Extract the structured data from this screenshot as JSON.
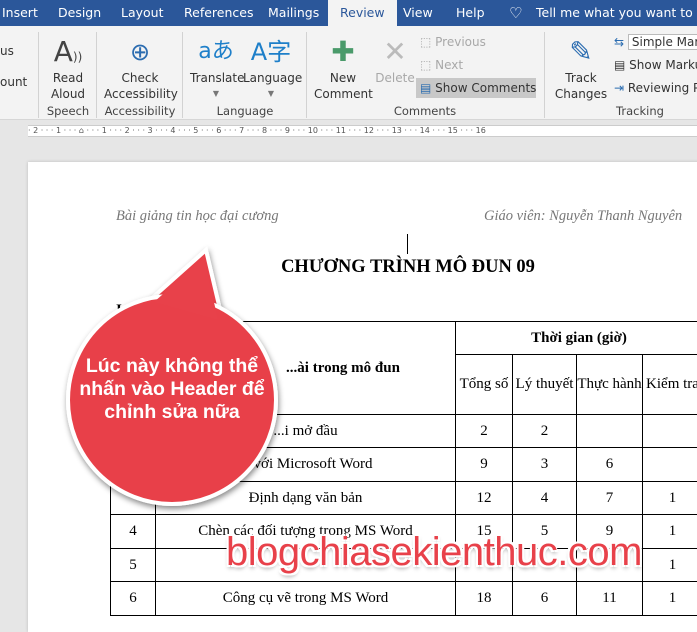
{
  "tabs": [
    "Insert",
    "Design",
    "Layout",
    "References",
    "Mailings",
    "Review",
    "View",
    "Help"
  ],
  "active_tab": "Review",
  "tell_me": "Tell me what you want to do",
  "ribbon": {
    "left_partial": [
      "us",
      "ount"
    ],
    "read_aloud": "Read Aloud",
    "speech": "Speech",
    "check_accessibility": "Check Accessibility",
    "accessibility": "Accessibility",
    "translate": "Translate",
    "language_btn": "Language",
    "language_group": "Language",
    "new_comment": "New Comment",
    "delete": "Delete",
    "previous": "Previous",
    "next": "Next",
    "show_comments": "Show Comments",
    "comments_group": "Comments",
    "track_changes": "Track Changes",
    "markup_select": "Simple Mar",
    "show_markup": "Show Marku",
    "reviewing_pane": "Reviewing P",
    "tracking_group": "Tracking"
  },
  "ruler": "· 2 · · · 1 · · · ⌂ · · · 1 · · · 2 · · · 3 · · · 4 · · · 5 · · · 6 · · · 7 · · · 8 · · · 9 · · · 10 · · · 11 · · · 12 · · · 13 · · · 14 · · · 15 · · · 16",
  "document": {
    "header_left": "Bài giảng tin học đại cương",
    "header_right": "Giáo viên: Nguyễn Thanh Nguyên",
    "title": "CHƯƠNG TRÌNH MÔ ĐUN 09",
    "subtitle": "I. ... Ô ĐUN",
    "table": {
      "col_name": "...ài trong mô đun",
      "time_header": "Thời gian (giờ)",
      "sub_headers": [
        "Tổng số",
        "Lý thuyết",
        "Thực hành",
        "Kiểm tra"
      ],
      "rows": [
        [
          "",
          "...i mở đầu",
          "2",
          "2",
          "",
          ""
        ],
        [
          "",
          "... với Microsoft Word",
          "9",
          "3",
          "6",
          ""
        ],
        [
          "",
          "Định dạng văn bản",
          "12",
          "4",
          "7",
          "1"
        ],
        [
          "4",
          "Chèn các đối tượng trong MS Word",
          "15",
          "5",
          "9",
          "1"
        ],
        [
          "5",
          "",
          "",
          "",
          "",
          "1"
        ],
        [
          "6",
          "Công cụ vẽ trong MS Word",
          "18",
          "6",
          "11",
          "1"
        ]
      ]
    }
  },
  "callout": "Lúc này không thể nhấn vào Header để chỉnh sửa nữa",
  "watermark": "blogchiasekienthuc.com",
  "colors": {
    "ribbon_tab_bar": "#2b579a",
    "callout": "#e8414a"
  }
}
